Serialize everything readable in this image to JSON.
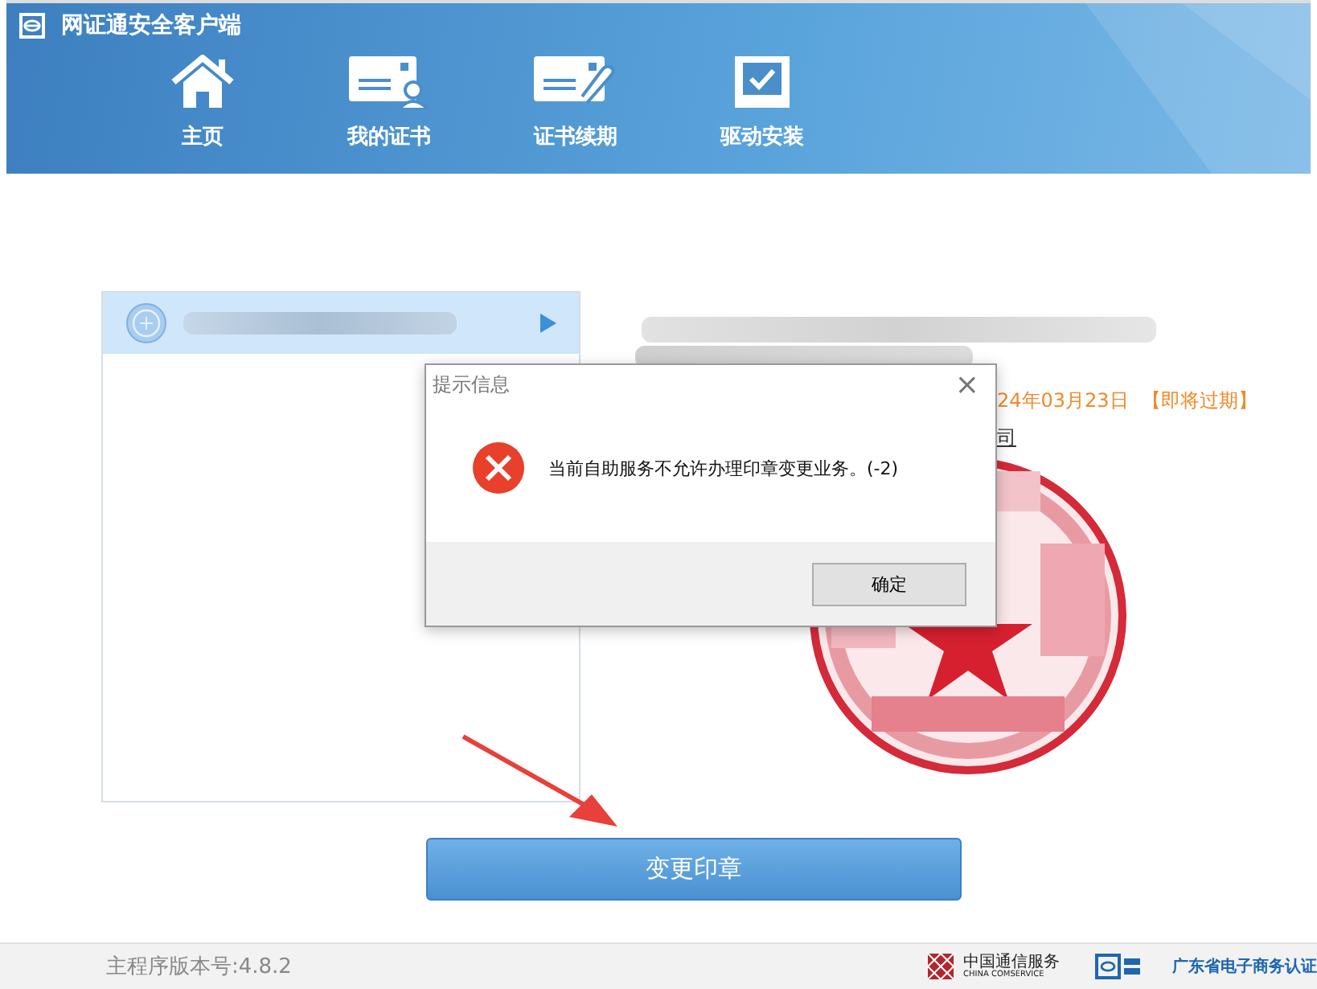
{
  "window": {
    "title": "网证通安全客户端"
  },
  "nav": [
    {
      "label": "主页"
    },
    {
      "label": "我的证书"
    },
    {
      "label": "证书续期"
    },
    {
      "label": "驱动安装"
    }
  ],
  "cert_list": {
    "items": [
      {
        "selected": true
      }
    ]
  },
  "cert_detail": {
    "validity": "24年03月23日",
    "status": "【即将过期】",
    "issuer_link": "司"
  },
  "dialog": {
    "title": "提示信息",
    "close": "×",
    "message": "当前自助服务不允许办理印章变更业务。(-2)",
    "ok_button": "确定"
  },
  "primary_button": "变更印章",
  "status_bar": {
    "version": "主程序版本号:4.8.2",
    "partner_cn": "中国通信服务",
    "partner_en": "CHINA COMSERVICE",
    "ca_name": "广东省电子商务认证"
  }
}
